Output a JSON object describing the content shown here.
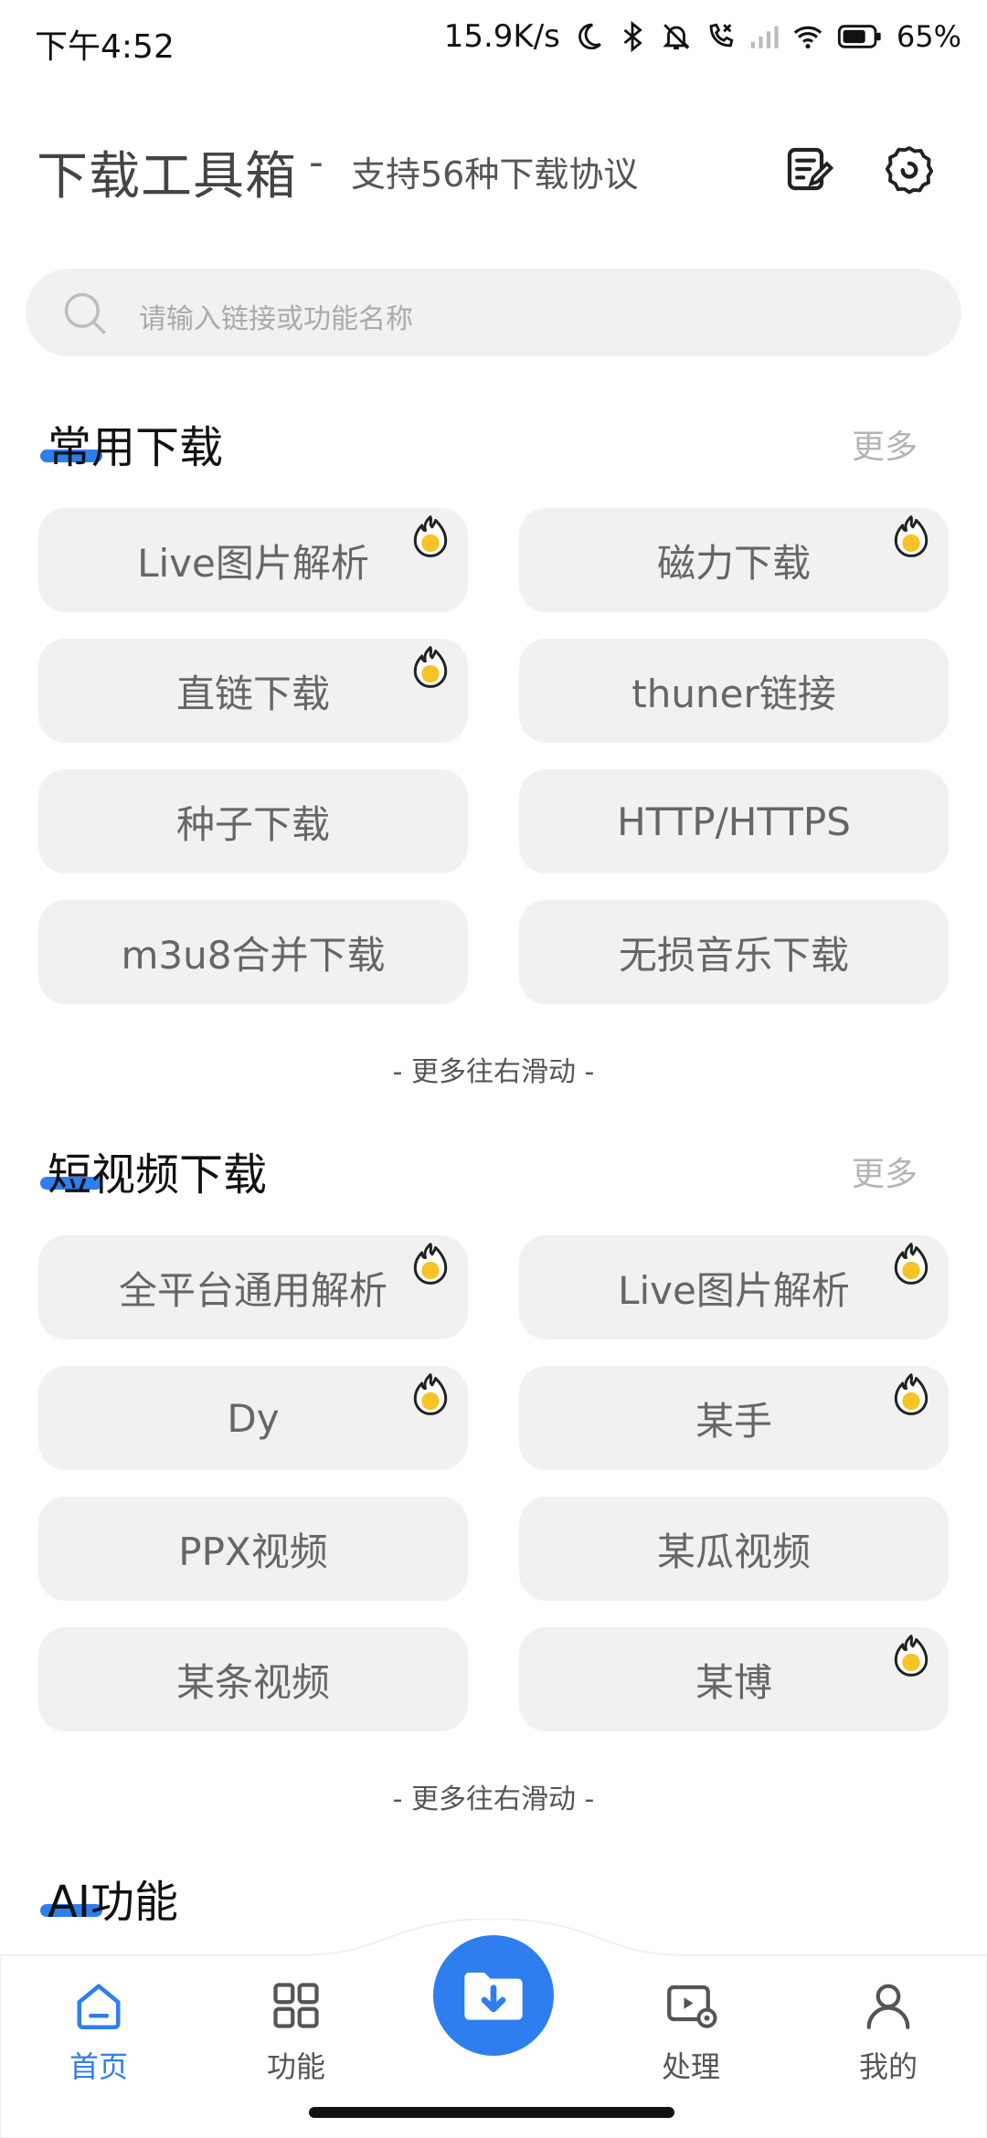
{
  "status_bar": {
    "time": "下午4:52",
    "speed": "15.9K/s",
    "battery": "65%"
  },
  "header": {
    "title": "下载工具箱",
    "separator": "-",
    "subtitle": "支持56种下载协议",
    "icons": [
      "notes-edit-icon",
      "settings-gear-icon"
    ]
  },
  "search": {
    "placeholder": "请输入链接或功能名称"
  },
  "sections": {
    "common": {
      "title": "常用下载",
      "more": "更多",
      "items": [
        {
          "label": "Live图片解析",
          "hot": true
        },
        {
          "label": "磁力下载",
          "hot": true
        },
        {
          "label": "直链下载",
          "hot": true
        },
        {
          "label": "thuner链接",
          "hot": false
        },
        {
          "label": "种子下载",
          "hot": false
        },
        {
          "label": "HTTP/HTTPS",
          "hot": false
        },
        {
          "label": "m3u8合并下载",
          "hot": false
        },
        {
          "label": "无损音乐下载",
          "hot": false
        }
      ],
      "hint": "- 更多往右滑动 -"
    },
    "short_video": {
      "title": "短视频下载",
      "more": "更多",
      "items": [
        {
          "label": "全平台通用解析",
          "hot": true
        },
        {
          "label": "Live图片解析",
          "hot": true
        },
        {
          "label": "Dy",
          "hot": true
        },
        {
          "label": "某手",
          "hot": true
        },
        {
          "label": "PPX视频",
          "hot": false
        },
        {
          "label": "某瓜视频",
          "hot": false
        },
        {
          "label": "某条视频",
          "hot": false
        },
        {
          "label": "某博",
          "hot": true
        }
      ],
      "hint": "- 更多往右滑动 -"
    },
    "ai": {
      "title": "AI功能"
    }
  },
  "nav": {
    "home": "首页",
    "features": "功能",
    "process": "处理",
    "mine": "我的"
  },
  "colors": {
    "accent": "#2f7ef0",
    "tile_bg": "#f1f1f1",
    "hot_yellow": "#f7c325"
  }
}
